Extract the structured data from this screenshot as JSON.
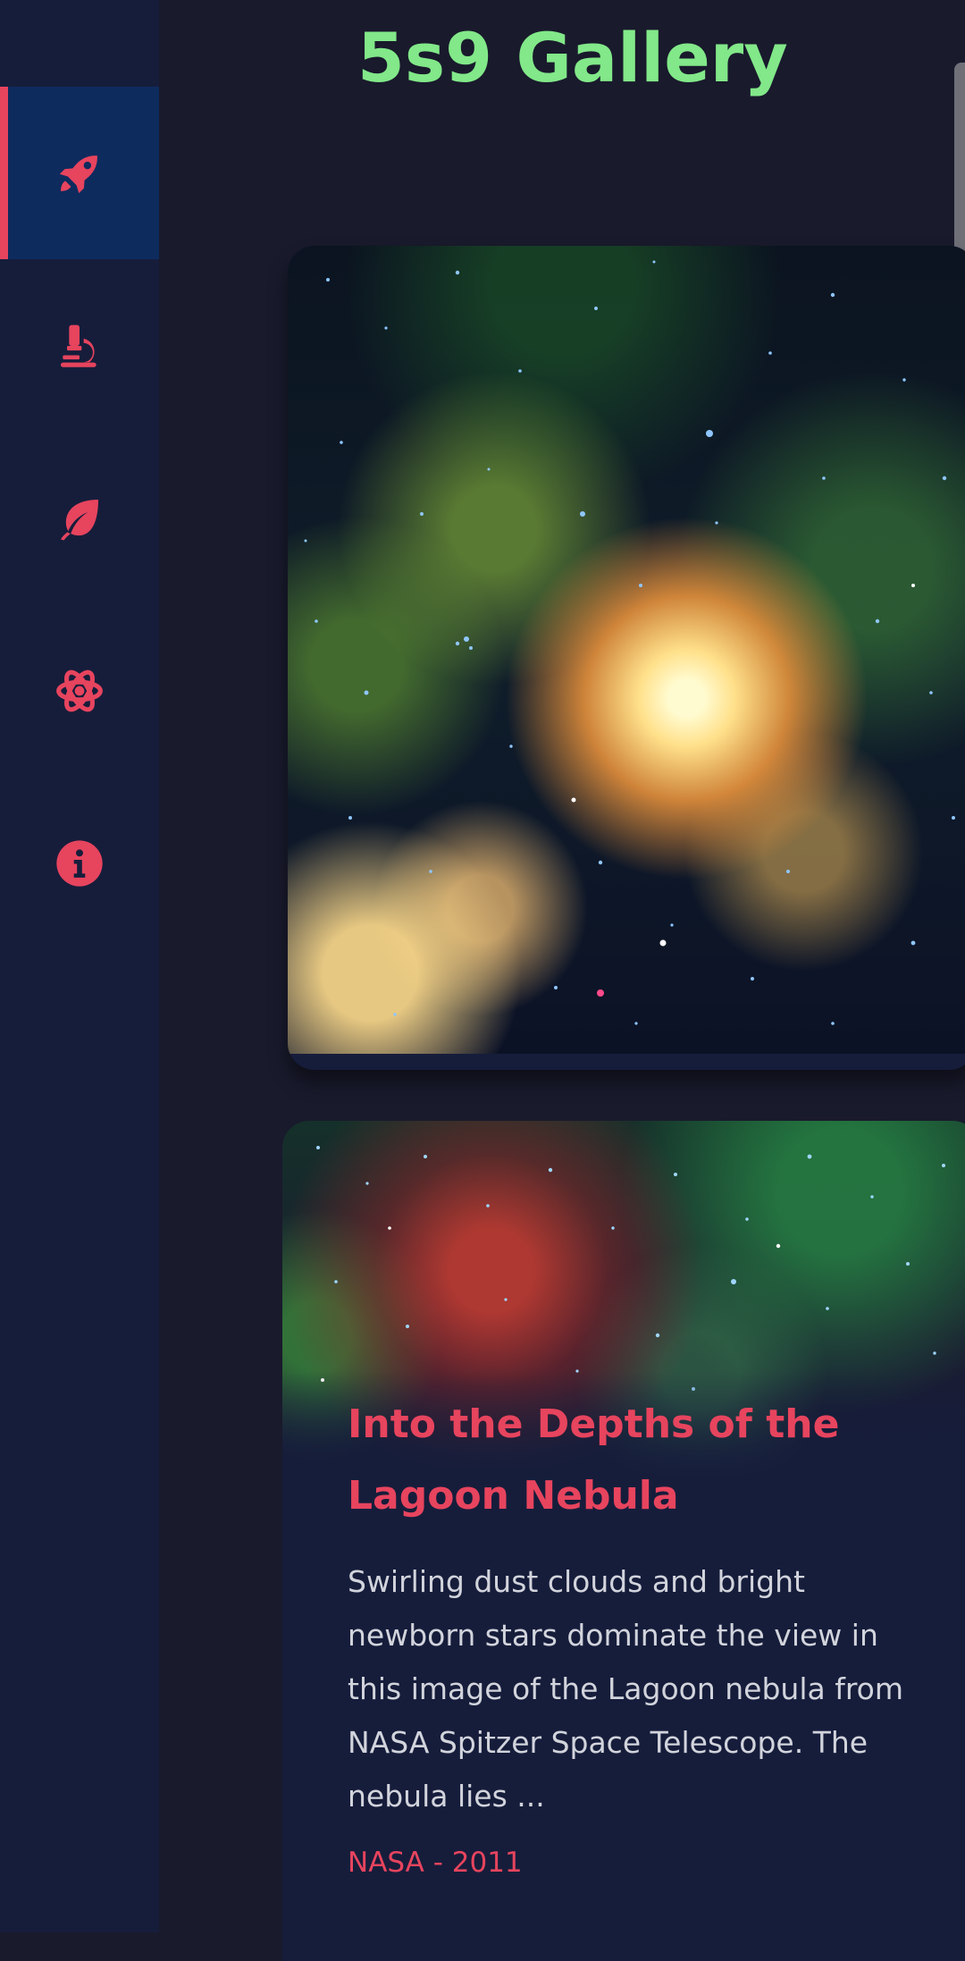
{
  "header": {
    "title": "5s9 Gallery"
  },
  "sidebar": {
    "items": [
      {
        "icon": "rocket-icon",
        "active": true
      },
      {
        "icon": "microscope-icon",
        "active": false
      },
      {
        "icon": "leaf-icon",
        "active": false
      },
      {
        "icon": "atom-icon",
        "active": false
      },
      {
        "icon": "info-icon",
        "active": false
      }
    ]
  },
  "gallery": {
    "cards": [
      {
        "title": "",
        "description": "",
        "meta": ""
      },
      {
        "title": "Into the Depths of the Lagoon Nebula",
        "description": "Swirling dust clouds and bright newborn stars dominate the view in this image of the Lagoon nebula from NASA Spitzer Space Telescope. The nebula lies ...",
        "meta": "NASA - 2011"
      }
    ]
  },
  "colors": {
    "accent": "#e7445e",
    "title": "#82e889",
    "sidebar_bg": "#161d3b",
    "active_bg": "#0e2b5e",
    "page_bg": "#191a2c"
  }
}
